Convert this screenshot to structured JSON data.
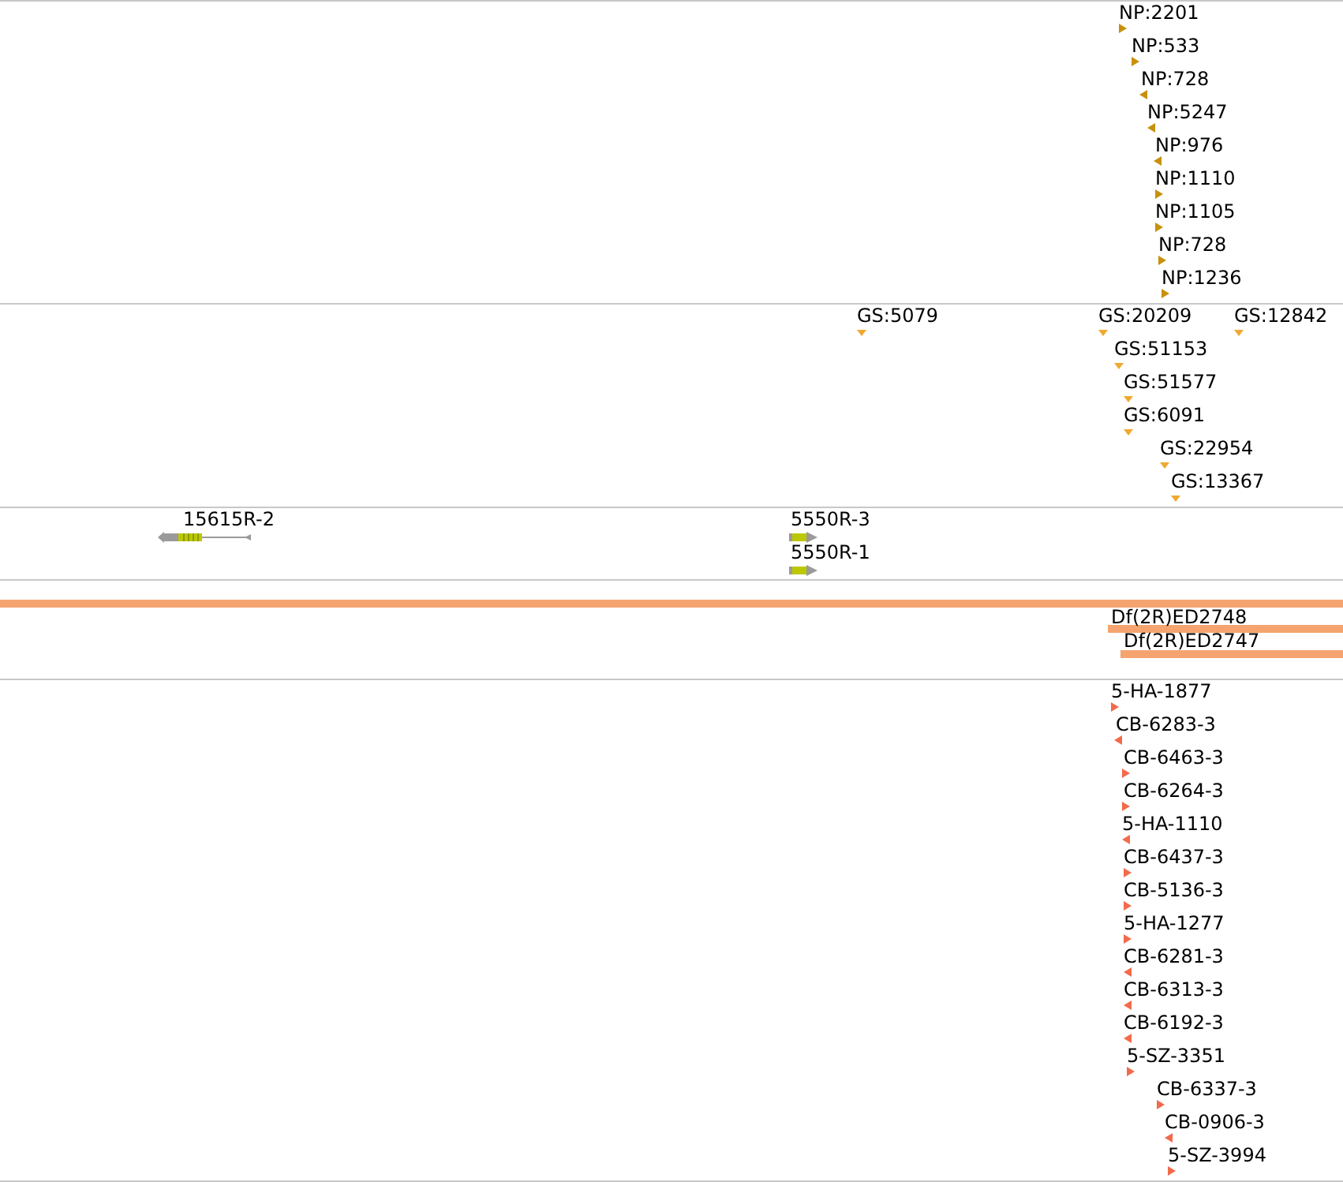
{
  "tracks": [
    {
      "kind": "stranded_markers",
      "color": "#c8900c",
      "features": [
        {
          "label": "NP:2201",
          "reverse": false
        },
        {
          "label": "NP:533",
          "reverse": false
        },
        {
          "label": "NP:728",
          "reverse": true
        },
        {
          "label": "NP:5247",
          "reverse": true
        },
        {
          "label": "NP:976",
          "reverse": true
        },
        {
          "label": "NP:1110",
          "reverse": false
        },
        {
          "label": "NP:1105",
          "reverse": false
        },
        {
          "label": "NP:728",
          "reverse": false
        },
        {
          "label": "NP:1236",
          "reverse": false
        }
      ]
    },
    {
      "kind": "markers",
      "color": "#f0a830",
      "features": [
        {
          "label": "GS:5079"
        },
        {
          "label": "GS:20209"
        },
        {
          "label": "GS:12842"
        },
        {
          "label": "GS:51153"
        },
        {
          "label": "GS:51577"
        },
        {
          "label": "GS:6091"
        },
        {
          "label": "GS:22954"
        },
        {
          "label": "GS:13367"
        }
      ]
    },
    {
      "kind": "transcripts",
      "features": [
        {
          "label": "15615R-2",
          "reverse": true
        },
        {
          "label": "5550R-3",
          "reverse": false
        },
        {
          "label": "5550R-1",
          "reverse": false
        }
      ]
    },
    {
      "kind": "bars",
      "color": "#f5a470",
      "features": [
        {
          "spans_view": true
        },
        {
          "label": "Df(2R)ED2748",
          "spans_view": false
        },
        {
          "label": "Df(2R)ED2747",
          "spans_view": false
        }
      ]
    },
    {
      "kind": "stranded_markers",
      "color": "#f36a4b",
      "features": [
        {
          "label": "5-HA-1877",
          "reverse": false
        },
        {
          "label": "CB-6283-3",
          "reverse": true
        },
        {
          "label": "CB-6463-3",
          "reverse": false
        },
        {
          "label": "CB-6264-3",
          "reverse": false
        },
        {
          "label": "5-HA-1110",
          "reverse": true
        },
        {
          "label": "CB-6437-3",
          "reverse": false
        },
        {
          "label": "CB-5136-3",
          "reverse": false
        },
        {
          "label": "5-HA-1277",
          "reverse": false
        },
        {
          "label": "CB-6281-3",
          "reverse": true
        },
        {
          "label": "CB-6313-3",
          "reverse": true
        },
        {
          "label": "CB-6192-3",
          "reverse": true
        },
        {
          "label": "5-SZ-3351",
          "reverse": false
        },
        {
          "label": "CB-6337-3",
          "reverse": false
        },
        {
          "label": "CB-0906-3",
          "reverse": true
        },
        {
          "label": "5-SZ-3994",
          "reverse": false
        }
      ]
    }
  ]
}
